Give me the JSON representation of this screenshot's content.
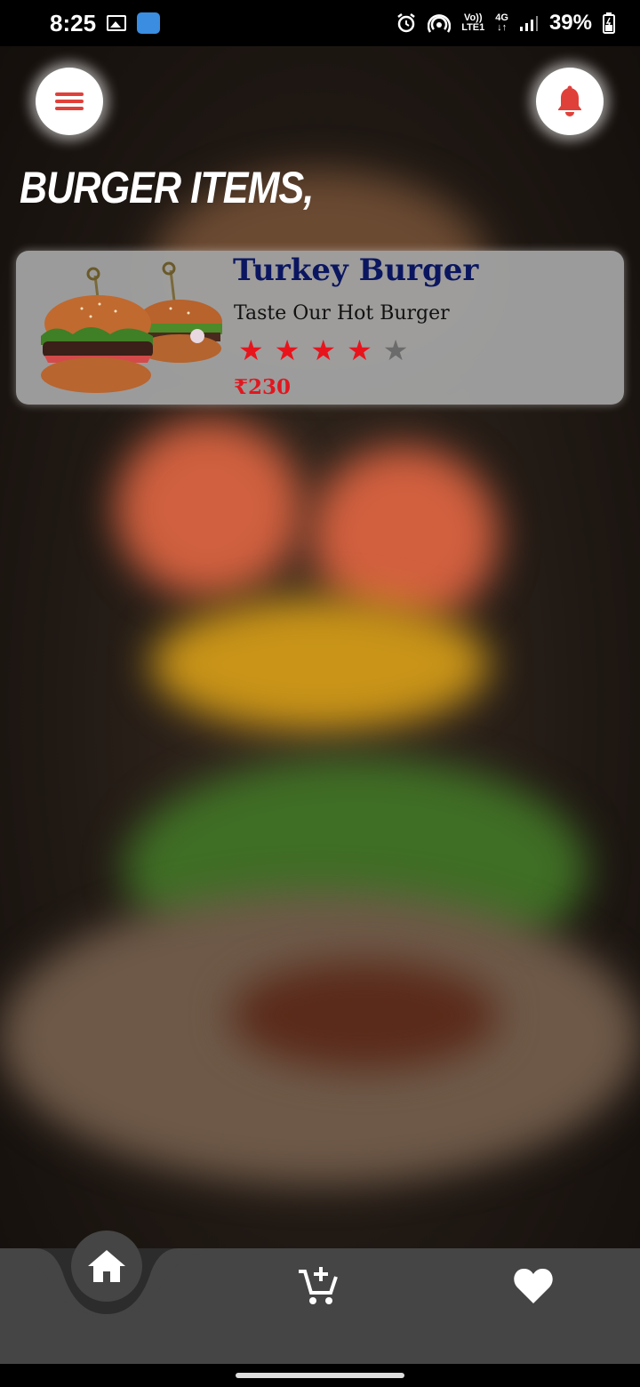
{
  "status_bar": {
    "time": "8:25",
    "network_top": "Vo))",
    "network_bottom": "LTE1",
    "gen_top": "4G",
    "gen_bottom": "↓↑",
    "battery": "39%"
  },
  "header": {
    "menu_icon": "hamburger-menu-icon",
    "bell_icon": "bell-icon",
    "accent_color": "#e0403a"
  },
  "section": {
    "title": "BURGER ITEMS,"
  },
  "items": [
    {
      "name": "Turkey Burger",
      "subtitle": "Taste Our Hot Burger",
      "rating": 4,
      "rating_max": 5,
      "price": "₹230"
    }
  ],
  "bottom_nav": {
    "items": [
      {
        "icon": "home-icon",
        "active": true
      },
      {
        "icon": "add-to-cart-icon",
        "active": false
      },
      {
        "icon": "heart-icon",
        "active": false
      }
    ]
  }
}
